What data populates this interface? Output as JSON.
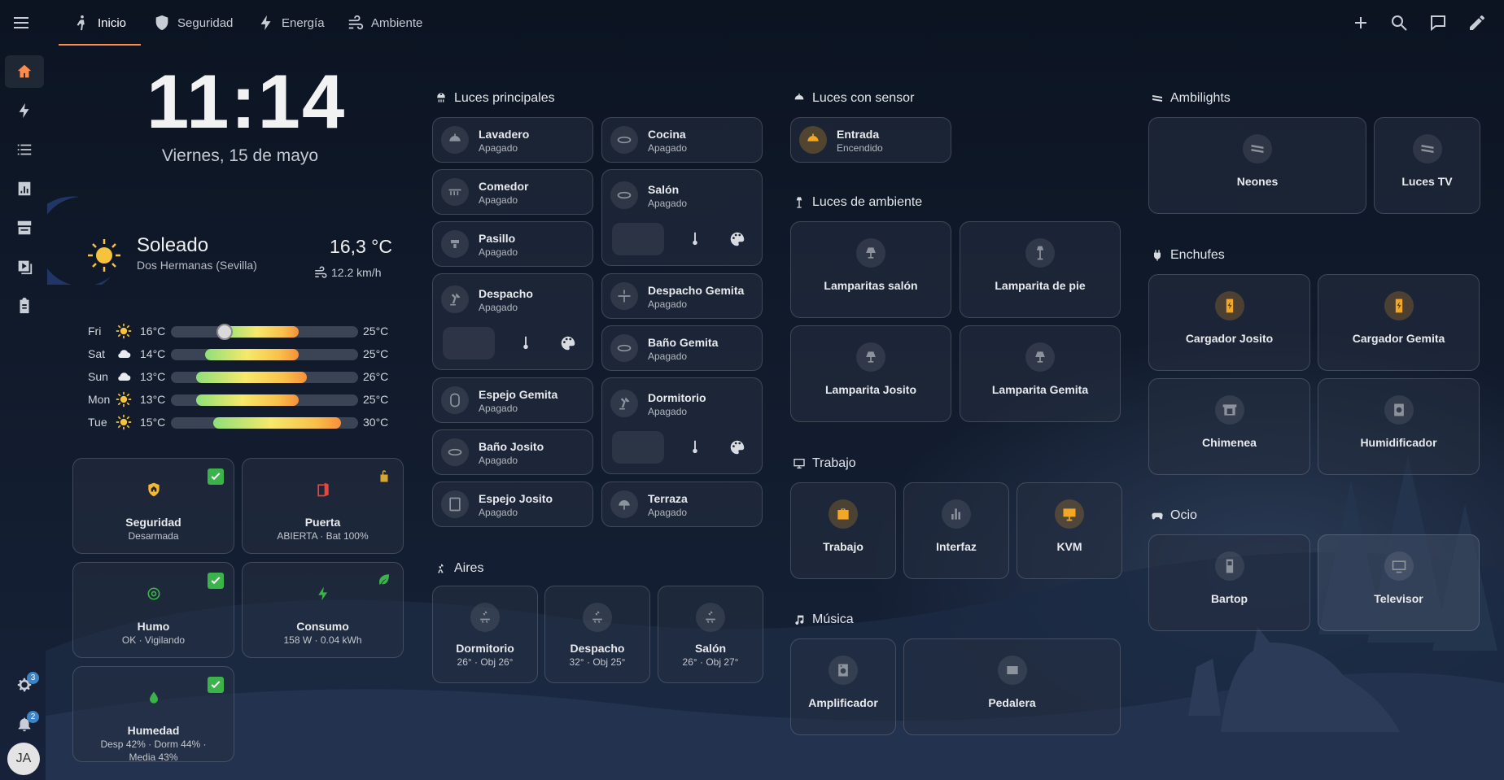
{
  "tabs": [
    {
      "label": "Inicio",
      "icon": "person-walking-icon"
    },
    {
      "label": "Seguridad",
      "icon": "shield-icon"
    },
    {
      "label": "Energía",
      "icon": "lightning-icon"
    },
    {
      "label": "Ambiente",
      "icon": "wind-icon"
    }
  ],
  "sidebar": {
    "items": [
      "home-icon",
      "lightning-icon",
      "list-icon",
      "chart-icon",
      "hacs-icon",
      "media-icon",
      "clipboard-icon"
    ],
    "settings_badge": "3",
    "notifications_badge": "2",
    "avatar": "JA"
  },
  "clock": {
    "time": "11:14",
    "date": "Viernes, 15 de mayo"
  },
  "weather": {
    "condition": "Soleado",
    "location": "Dos Hermanas (Sevilla)",
    "temperature": "16,3 °C",
    "wind": "12.2 km/h",
    "forecast": [
      {
        "day": "Fri",
        "icon": "sun-icon",
        "low": "16°C",
        "high": "25°C",
        "low_value": 16,
        "high_value": 25,
        "current": 16.3
      },
      {
        "day": "Sat",
        "icon": "cloud-icon",
        "low": "14°C",
        "high": "25°C",
        "low_value": 14,
        "high_value": 25
      },
      {
        "day": "Sun",
        "icon": "cloud-icon",
        "low": "13°C",
        "high": "26°C",
        "low_value": 13,
        "high_value": 26
      },
      {
        "day": "Mon",
        "icon": "sun-icon",
        "low": "13°C",
        "high": "25°C",
        "low_value": 13,
        "high_value": 25
      },
      {
        "day": "Tue",
        "icon": "sun-icon",
        "low": "15°C",
        "high": "30°C",
        "low_value": 15,
        "high_value": 30
      }
    ]
  },
  "status": {
    "seguridad": {
      "name": "Seguridad",
      "state": "Desarmada"
    },
    "puerta": {
      "name": "Puerta",
      "state": "ABIERTA · Bat 100%"
    },
    "humo": {
      "name": "Humo",
      "state": "OK · Vigilando"
    },
    "consumo": {
      "name": "Consumo",
      "state": "158 W · 0.04 kWh"
    },
    "humedad": {
      "name": "Humedad",
      "state": "Desp 42% · Dorm 44% · Media 43%"
    }
  },
  "luces_principales": {
    "title": "Luces principales",
    "lavadero": {
      "name": "Lavadero",
      "state": "Apagado"
    },
    "cocina": {
      "name": "Cocina",
      "state": "Apagado"
    },
    "comedor": {
      "name": "Comedor",
      "state": "Apagado"
    },
    "salon": {
      "name": "Salón",
      "state": "Apagado"
    },
    "pasillo": {
      "name": "Pasillo",
      "state": "Apagado"
    },
    "despacho": {
      "name": "Despacho",
      "state": "Apagado"
    },
    "despacho_gemita": {
      "name": "Despacho Gemita",
      "state": "Apagado"
    },
    "bano_gemita": {
      "name": "Baño Gemita",
      "state": "Apagado"
    },
    "espejo_gemita": {
      "name": "Espejo Gemita",
      "state": "Apagado"
    },
    "dormitorio": {
      "name": "Dormitorio",
      "state": "Apagado"
    },
    "bano_josito": {
      "name": "Baño Josito",
      "state": "Apagado"
    },
    "espejo_josito": {
      "name": "Espejo Josito",
      "state": "Apagado"
    },
    "terraza": {
      "name": "Terraza",
      "state": "Apagado"
    }
  },
  "aires": {
    "title": "Aires",
    "units": [
      {
        "name": "Dormitorio",
        "state": "26° · Obj 26°"
      },
      {
        "name": "Despacho",
        "state": "32° · Obj 25°"
      },
      {
        "name": "Salón",
        "state": "26° · Obj 27°"
      }
    ]
  },
  "luces_sensor": {
    "title": "Luces con sensor",
    "entrada": {
      "name": "Entrada",
      "state": "Encendido"
    }
  },
  "luces_ambiente": {
    "title": "Luces de ambiente",
    "items": [
      "Lamparitas salón",
      "Lamparita de pie",
      "Lamparita Josito",
      "Lamparita Gemita"
    ]
  },
  "trabajo": {
    "title": "Trabajo",
    "items": [
      "Trabajo",
      "Interfaz",
      "KVM"
    ]
  },
  "musica": {
    "title": "Música",
    "items": [
      "Amplificador",
      "Pedalera"
    ]
  },
  "ambilights": {
    "title": "Ambilights",
    "items": [
      "Neones",
      "Luces TV"
    ]
  },
  "enchufes": {
    "title": "Enchufes",
    "items": [
      "Cargador Josito",
      "Cargador Gemita",
      "Chimenea",
      "Humidificador"
    ]
  },
  "ocio": {
    "title": "Ocio",
    "items": [
      "Bartop",
      "Televisor"
    ]
  },
  "colors": {
    "accent": "#ff8a4a",
    "active_icon": "#f5a623",
    "ok_green": "#3bb34a",
    "badge_blue": "#3d84c6"
  }
}
